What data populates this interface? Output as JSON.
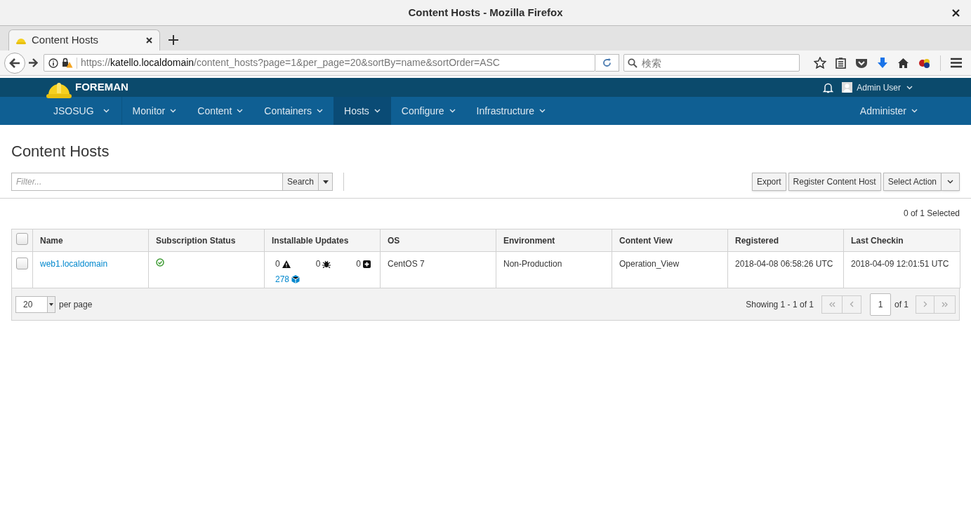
{
  "window": {
    "title": "Content Hosts - Mozilla Firefox"
  },
  "browser": {
    "tabs": [
      {
        "label": "Content Hosts",
        "selected": true
      }
    ],
    "url": {
      "scheme": "https://",
      "host": "katello.localdomain",
      "path": "/content_hosts?page=1&per_page=20&sortBy=name&sortOrder=ASC"
    },
    "search": {
      "placeholder": "検索"
    }
  },
  "header": {
    "brand": "FOREMAN",
    "user": "Admin User"
  },
  "nav": {
    "items": [
      {
        "label": "JSOSUG",
        "selected": false
      },
      {
        "label": "Monitor",
        "selected": false
      },
      {
        "label": "Content",
        "selected": false
      },
      {
        "label": "Containers",
        "selected": false
      },
      {
        "label": "Hosts",
        "selected": true
      },
      {
        "label": "Configure",
        "selected": false
      },
      {
        "label": "Infrastructure",
        "selected": false
      }
    ],
    "right_items": [
      {
        "label": "Administer",
        "selected": false
      }
    ]
  },
  "page": {
    "title": "Content Hosts"
  },
  "toolbar": {
    "filter": {
      "placeholder": "Filter..."
    },
    "search_button": "Search",
    "actions": [
      "Export",
      "Register Content Host"
    ],
    "select_action": "Select Action"
  },
  "selected_count": "0 of 1 Selected",
  "table": {
    "select_all": {
      "checked": false
    },
    "columns": [
      "Name",
      "Subscription Status",
      "Installable Updates",
      "OS",
      "Environment",
      "Content View",
      "Registered",
      "Last Checkin"
    ],
    "rows": [
      {
        "checked": false,
        "name": "web1.localdomain",
        "subscription_valid": true,
        "security": "0",
        "bugfix": "0",
        "enhancement": "0",
        "packages": "278",
        "os": "CentOS 7",
        "environment": "Non-Production",
        "content_view": "Operation_View",
        "registered": "2018-04-08 06:58:26 UTC",
        "last_checkin": "2018-04-09 12:01:51 UTC"
      }
    ]
  },
  "pagination": {
    "per_page": "20",
    "per_page_label": "per page",
    "showing": "Showing 1 - 1 of 1",
    "page": "1",
    "of": "of 1"
  }
}
